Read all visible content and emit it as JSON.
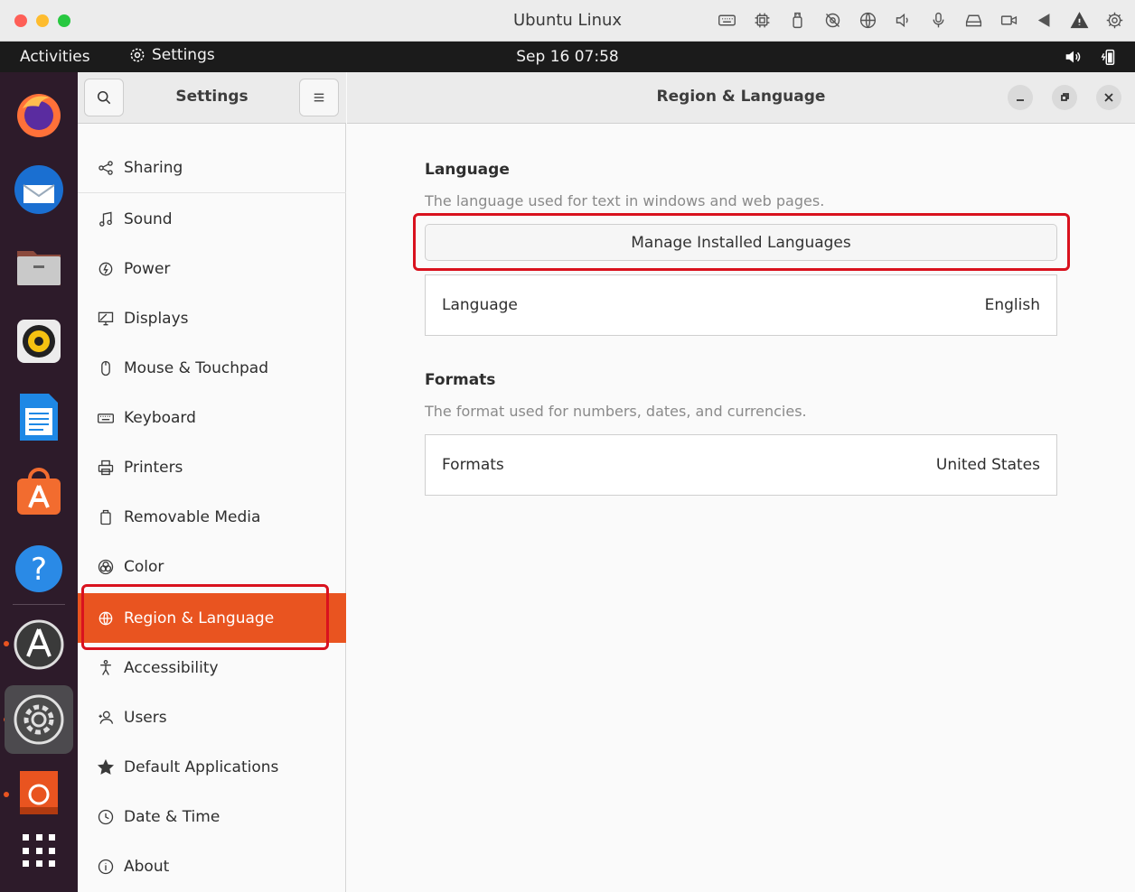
{
  "mac": {
    "window_title": "Ubuntu Linux",
    "traffic_colors": [
      "#fe5f57",
      "#febc2e",
      "#28c840"
    ],
    "status_icons": [
      "keyboard-icon",
      "cpu-icon",
      "usb-icon",
      "camera-off-icon",
      "globe-icon",
      "speaker-icon",
      "microphone-icon",
      "drive-icon",
      "video-icon",
      "back-arrow-icon",
      "warning-icon",
      "gear-icon"
    ]
  },
  "topbar": {
    "activities": "Activities",
    "app_name": "Settings",
    "clock": "Sep 16  07:58"
  },
  "dock": {
    "apps": [
      "Firefox",
      "Thunderbird",
      "Files",
      "Rhythmbox",
      "LibreOffice Writer",
      "Ubuntu Software",
      "Help",
      "Software Updater",
      "Settings",
      "Ubuntu Installer",
      "Show Applications"
    ]
  },
  "sidebar": {
    "title": "Settings",
    "items": [
      {
        "label": "Sharing",
        "icon": "share-icon"
      },
      {
        "label": "Sound",
        "icon": "music-note-icon"
      },
      {
        "label": "Power",
        "icon": "power-icon"
      },
      {
        "label": "Displays",
        "icon": "display-icon"
      },
      {
        "label": "Mouse & Touchpad",
        "icon": "mouse-icon"
      },
      {
        "label": "Keyboard",
        "icon": "keyboard-icon"
      },
      {
        "label": "Printers",
        "icon": "printer-icon"
      },
      {
        "label": "Removable Media",
        "icon": "removable-media-icon"
      },
      {
        "label": "Color",
        "icon": "color-icon"
      },
      {
        "label": "Region & Language",
        "icon": "globe-icon",
        "active": true
      },
      {
        "label": "Accessibility",
        "icon": "accessibility-icon"
      },
      {
        "label": "Users",
        "icon": "users-icon"
      },
      {
        "label": "Default Applications",
        "icon": "star-icon"
      },
      {
        "label": "Date & Time",
        "icon": "clock-icon"
      },
      {
        "label": "About",
        "icon": "info-icon"
      }
    ]
  },
  "main": {
    "title": "Region & Language",
    "language": {
      "heading": "Language",
      "description": "The language used for text in windows and web pages.",
      "manage_button": "Manage Installed Languages",
      "row_label": "Language",
      "row_value": "English"
    },
    "formats": {
      "heading": "Formats",
      "description": "The format used for numbers, dates, and currencies.",
      "row_label": "Formats",
      "row_value": "United States"
    }
  },
  "colors": {
    "accent": "#e95420",
    "highlight": "#d9121e",
    "dock_bg": "#2d1b2a"
  }
}
